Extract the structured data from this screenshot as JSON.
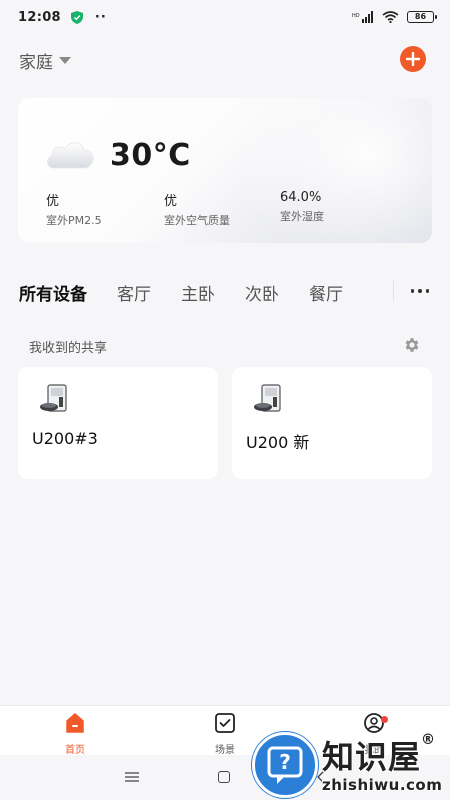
{
  "status_bar": {
    "time": "12:08",
    "dots": "··",
    "signal_label": "HD",
    "battery": "86"
  },
  "header": {
    "home_name": "家庭",
    "add_icon": "plus-icon"
  },
  "weather": {
    "temperature": "30°C",
    "icon": "cloud-icon",
    "items": [
      {
        "value": "优",
        "label": "室外PM2.5"
      },
      {
        "value": "优",
        "label": "室外空气质量"
      },
      {
        "value": "64.0%",
        "label": "室外湿度"
      }
    ]
  },
  "tabs": [
    {
      "label": "所有设备",
      "active": true
    },
    {
      "label": "客厅"
    },
    {
      "label": "主卧"
    },
    {
      "label": "次卧"
    },
    {
      "label": "餐厅"
    }
  ],
  "shared": {
    "title": "我收到的共享",
    "settings_icon": "gear-icon"
  },
  "devices": [
    {
      "name": "U200#3",
      "icon": "robot-vacuum-station-icon"
    },
    {
      "name": "U200 新",
      "icon": "robot-vacuum-station-icon"
    }
  ],
  "bottom_nav": [
    {
      "label": "首页",
      "icon": "home-icon",
      "active": true
    },
    {
      "label": "场景",
      "icon": "scene-check-icon"
    },
    {
      "label": "我的",
      "icon": "profile-icon",
      "badge": true
    }
  ],
  "watermark": {
    "cn": "知识屋",
    "reg": "®",
    "en": "zhishiwu.com"
  },
  "colors": {
    "accent": "#f05a28",
    "watermark_blue": "#2b7fd6"
  }
}
